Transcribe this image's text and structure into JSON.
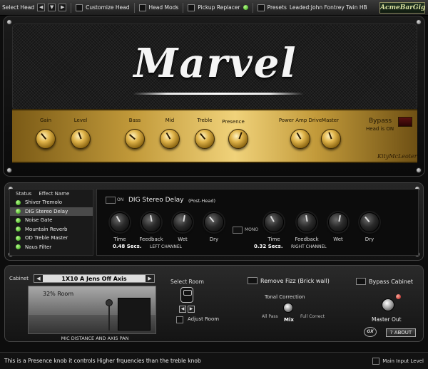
{
  "topbar": {
    "select_head_label": "Select Head",
    "customize_head_label": "Customize Head",
    "head_mods_label": "Head Mods",
    "pickup_replacer_label": "Pickup Replacer",
    "presets_label": "Presets",
    "loaded_text": "Leaded:John Fontrey Twin HB",
    "brand": "AcmeBarGig"
  },
  "amp": {
    "logo": "Marvel",
    "knobs": [
      {
        "label": "Gain"
      },
      {
        "label": "Level"
      },
      {
        "label": "Bass"
      },
      {
        "label": "Mid"
      },
      {
        "label": "Treble"
      },
      {
        "label": "Presence"
      },
      {
        "label": "Power Amp Drive"
      },
      {
        "label": "Master"
      }
    ],
    "bypass_label": "Bypass",
    "head_status": "Head is ON",
    "signature": "KityMcLeoter"
  },
  "effects": {
    "col_status": "Status",
    "col_name": "Effect Name",
    "items": [
      {
        "name": "Shiver Tremolo",
        "on": true,
        "selected": false
      },
      {
        "name": "DIG Stereo Delay",
        "on": true,
        "selected": true
      },
      {
        "name": "Noise Gate",
        "on": true,
        "selected": false
      },
      {
        "name": "Mountain Reverb",
        "on": true,
        "selected": false
      },
      {
        "name": "OD Treble Master",
        "on": true,
        "selected": false
      },
      {
        "name": "Naus Filter",
        "on": true,
        "selected": false
      }
    ],
    "on_label": "ON",
    "title": "DIG Stereo Delay",
    "subtitle": "(Post-Head)",
    "mono_label": "MONO",
    "left_channel": "LEFT CHANNEL",
    "right_channel": "RIGHT CHANNEL",
    "left_time": "0.48 Secs.",
    "right_time": "0.32 Secs.",
    "knob_labels": [
      "Time",
      "Feedback",
      "Wet",
      "Dry",
      "Time",
      "Feedback",
      "Wet",
      "Dry"
    ]
  },
  "cabinet": {
    "cabinet_label": "Cabinet",
    "cabinet_name": "1X10 A Jens Off Axis",
    "room_percent": "32% Room",
    "mic_distance": "MIC DISTANCE AND AXIS PAN",
    "select_room": "Select Room",
    "adjust_room": "Adjust Room",
    "remove_fizz": "Remove Fizz (Brick wall)",
    "tonal_correction": "Tonal Correction",
    "all_pass": "All Pass",
    "full_correct": "Full Correct",
    "mix": "Mix",
    "bypass_cabinet": "Bypass Cabinet",
    "master_out": "Master Out",
    "about": "ABOUT",
    "gx_logo": "GX"
  },
  "status": {
    "message": "This is a Presence knob it controls Higher frquencies than the treble knob",
    "main_input_level": "Main Input Level"
  },
  "colors": {
    "gold_panel": "#c29a3a",
    "led_on": "#2f9a10",
    "bypass_off": "#5a1010"
  }
}
